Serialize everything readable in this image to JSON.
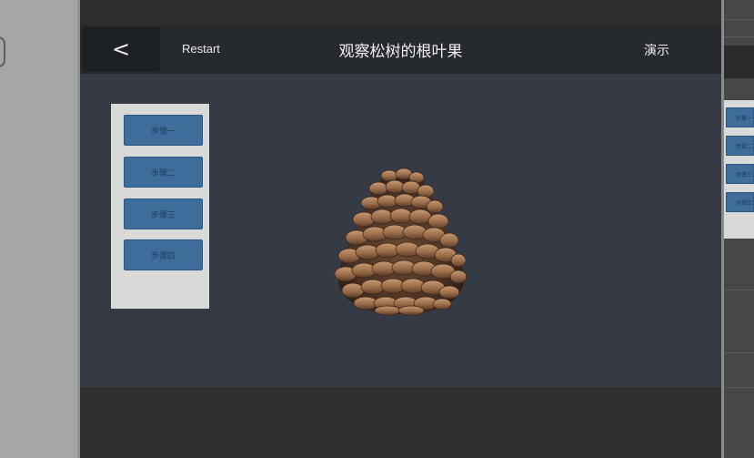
{
  "header": {
    "back_label": "<",
    "restart_label": "Restart",
    "title": "观察松树的根叶果",
    "demo_label": "演示"
  },
  "steps": [
    {
      "label": "步骤一"
    },
    {
      "label": "步骤二"
    },
    {
      "label": "步骤三"
    },
    {
      "label": "步骤四"
    }
  ],
  "right_preview": {
    "steps": [
      {
        "label": "步骤一"
      },
      {
        "label": "步骤二"
      },
      {
        "label": "步骤三"
      },
      {
        "label": "步骤四"
      }
    ]
  },
  "colors": {
    "header_bg": "#262a2f",
    "stage_bg": "#353a44",
    "step_button": "#3d6d9a",
    "step_panel": "#d9d9d9"
  },
  "model": {
    "name": "pinecone-model"
  }
}
